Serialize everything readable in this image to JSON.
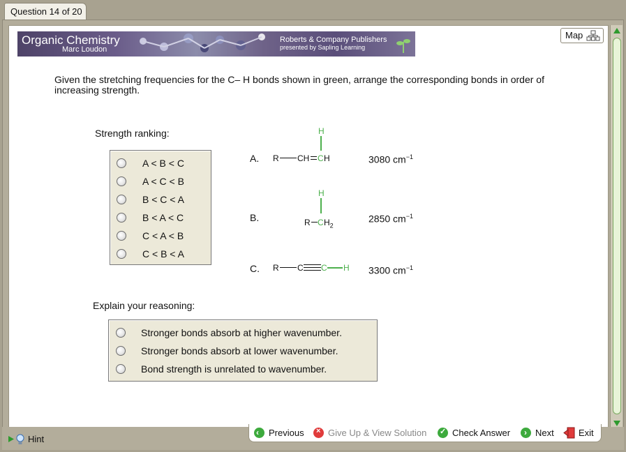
{
  "tab": {
    "label": "Question 14 of 20"
  },
  "banner": {
    "title": "Organic Chemistry",
    "author": "Marc Loudon",
    "publisher": "Roberts & Company Publishers",
    "presented": "presented by Sapling Learning"
  },
  "map": {
    "label": "Map"
  },
  "question": {
    "text": "Given the stretching frequencies for the C– H bonds shown in green, arrange the corresponding bonds in order of increasing strength."
  },
  "ranking": {
    "label": "Strength ranking:",
    "options": [
      "A < B < C",
      "A < C < B",
      "B < C < A",
      "B < A < C",
      "C < A < B",
      "C < B < A"
    ]
  },
  "molecules": {
    "A": {
      "letter": "A.",
      "r": "R",
      "ch": "CH",
      "c": "C",
      "h": "H",
      "h_top": "H",
      "freq": "3080 cm",
      "exp": "−1"
    },
    "B": {
      "letter": "B.",
      "r": "R",
      "c": "C",
      "h2": "H",
      "sub": "2",
      "h_top": "H",
      "freq": "2850 cm",
      "exp": "−1"
    },
    "C": {
      "letter": "C.",
      "r": "R",
      "c1": "C",
      "c2": "C",
      "h": "H",
      "freq": "3300 cm",
      "exp": "−1"
    }
  },
  "reasoning": {
    "label": "Explain your reasoning:",
    "options": [
      "Stronger bonds absorb at higher wavenumber.",
      "Stronger bonds absorb at lower wavenumber.",
      "Bond strength is unrelated to wavenumber."
    ]
  },
  "footer": {
    "hint": "Hint",
    "previous": "Previous",
    "giveup": "Give Up & View Solution",
    "check": "Check Answer",
    "next": "Next",
    "exit": "Exit"
  },
  "colors": {
    "accent_green": "#4db04d",
    "banner_purple": "#5a4e7a",
    "panel_bg": "#ffffff",
    "frame_bg": "#b3ad9b"
  }
}
